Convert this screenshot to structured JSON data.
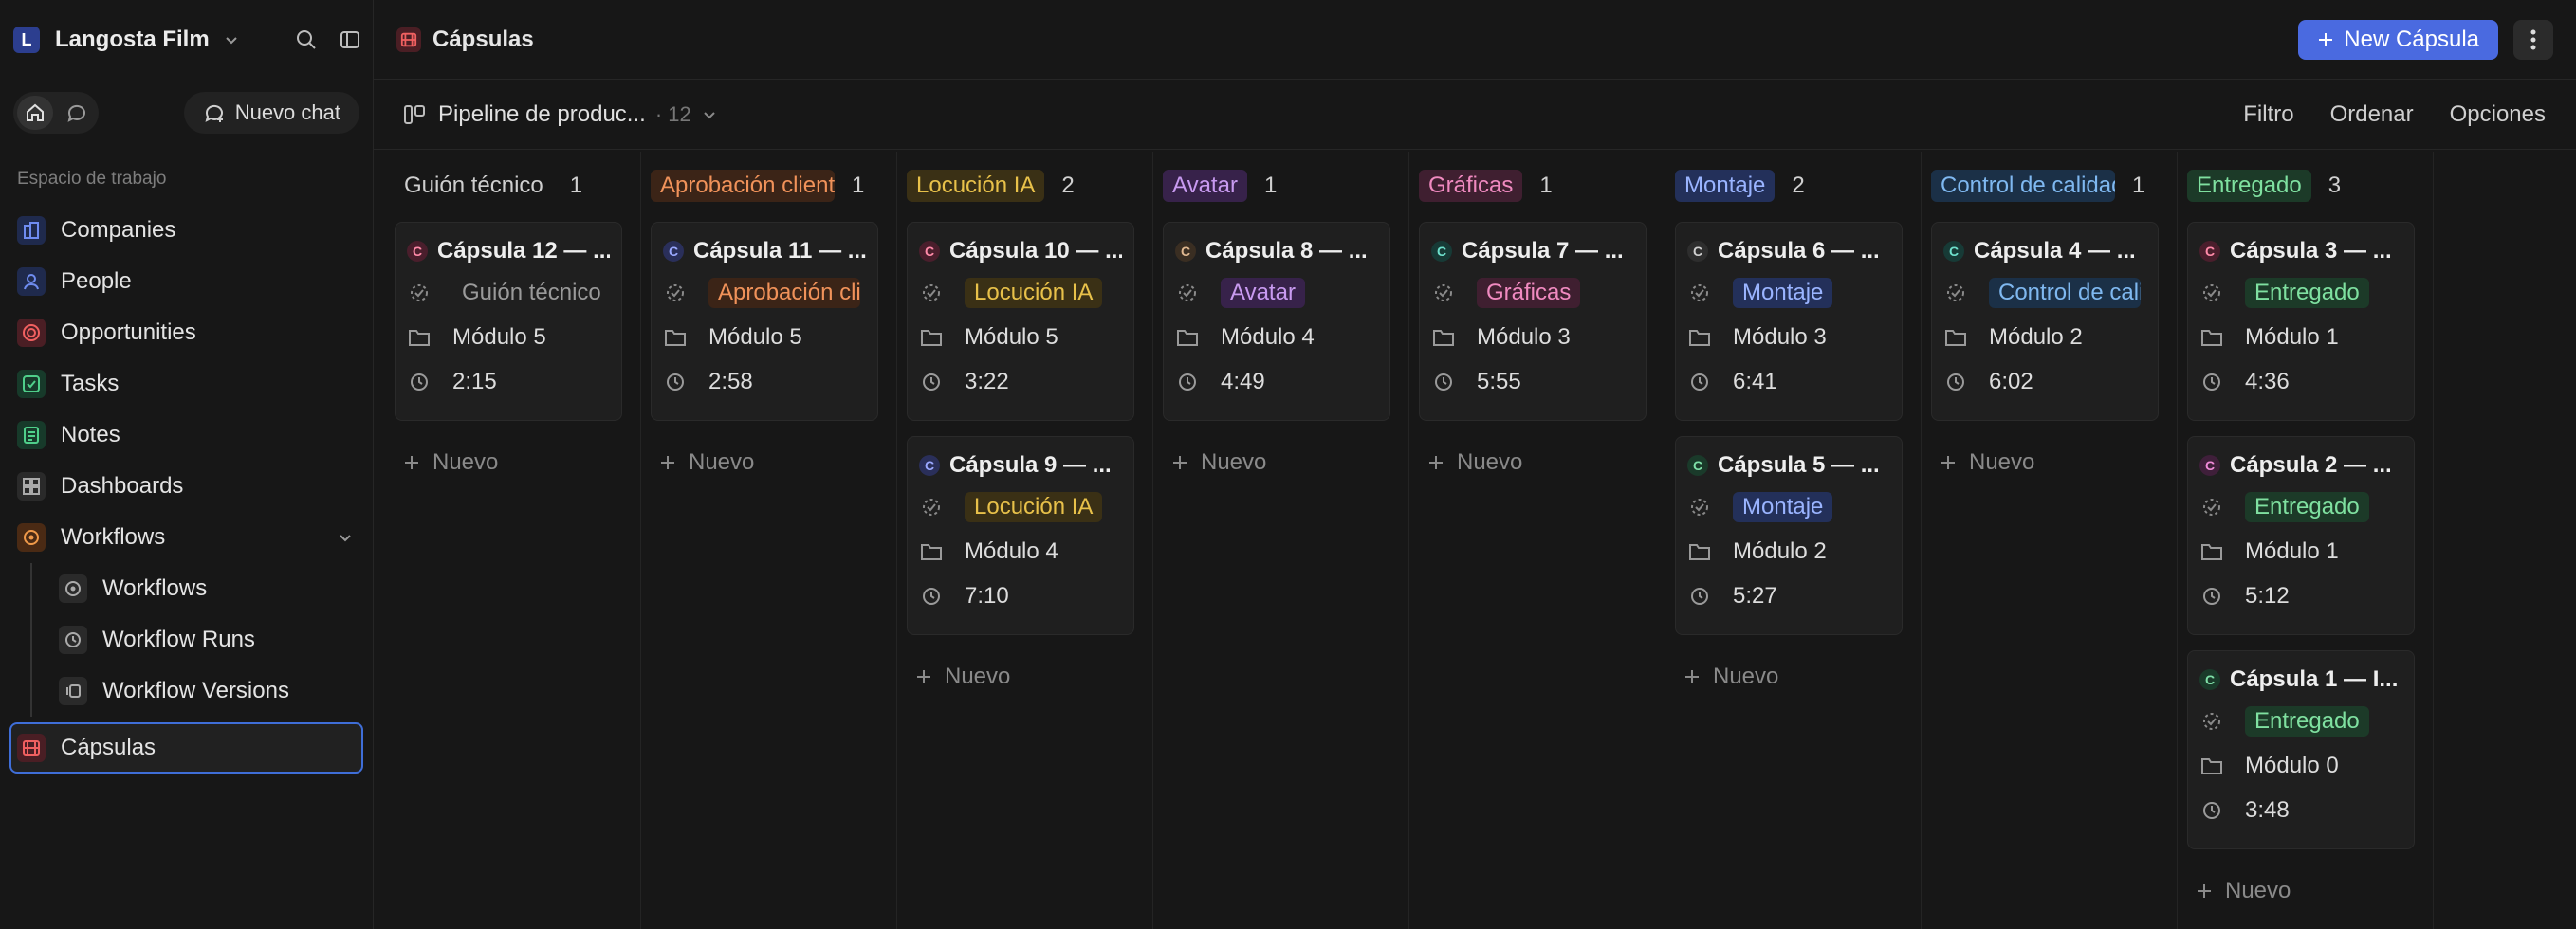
{
  "workspace": {
    "initial": "L",
    "name": "Langosta Film"
  },
  "sidebar": {
    "new_chat": "Nuevo chat",
    "section": "Espacio de trabajo",
    "items": [
      {
        "label": "Companies",
        "icon": "building-icon",
        "color": "#5b7be6"
      },
      {
        "label": "People",
        "icon": "person-icon",
        "color": "#5b7be6"
      },
      {
        "label": "Opportunities",
        "icon": "target-icon",
        "color": "#e0524c"
      },
      {
        "label": "Tasks",
        "icon": "checkbox-icon",
        "color": "#3fb47a"
      },
      {
        "label": "Notes",
        "icon": "note-icon",
        "color": "#3fb47a"
      },
      {
        "label": "Dashboards",
        "icon": "grid-icon",
        "color": "#9a9a9a"
      },
      {
        "label": "Workflows",
        "icon": "workflow-icon",
        "color": "#e8863a"
      }
    ],
    "sub_items": [
      {
        "label": "Workflows",
        "icon": "workflow-icon"
      },
      {
        "label": "Workflow Runs",
        "icon": "history-icon"
      },
      {
        "label": "Workflow Versions",
        "icon": "versions-icon"
      }
    ],
    "selected": {
      "label": "Cápsulas",
      "icon": "film-icon",
      "color": "#e0524c"
    }
  },
  "header": {
    "title": "Cápsulas",
    "new_button": "New Cápsula"
  },
  "view": {
    "name": "Pipeline de produc...",
    "count": "· 12",
    "actions": [
      "Filtro",
      "Ordenar",
      "Opciones"
    ]
  },
  "board": {
    "add_label": "Nuevo",
    "columns": [
      {
        "name": "Guión técnico",
        "count": "1",
        "bg": "transparent",
        "fg": "#cfcfcf",
        "cards": [
          {
            "title": "Cápsula 12 — ...",
            "av": "#4a1e2c",
            "avfg": "#ff8aa8",
            "module": "Módulo 5",
            "duration": "2:15"
          }
        ]
      },
      {
        "name": "Aprobación cliente",
        "count": "1",
        "bg": "#3b2417",
        "fg": "#f0925a",
        "cards": [
          {
            "title": "Cápsula 11 — ...",
            "av": "#2a2f5a",
            "avfg": "#9aa8ff",
            "module": "Módulo 5",
            "duration": "2:58"
          }
        ]
      },
      {
        "name": "Locución IA",
        "count": "2",
        "bg": "#3a3015",
        "fg": "#e8c14a",
        "cards": [
          {
            "title": "Cápsula 10 — ...",
            "av": "#4a1e2c",
            "avfg": "#ff8aa8",
            "module": "Módulo 5",
            "duration": "3:22"
          },
          {
            "title": "Cápsula 9 — ...",
            "av": "#2a2f5a",
            "avfg": "#9aa8ff",
            "module": "Módulo 4",
            "duration": "7:10"
          }
        ]
      },
      {
        "name": "Avatar",
        "count": "1",
        "bg": "#37224a",
        "fg": "#c89af0",
        "cards": [
          {
            "title": "Cápsula 8 — ...",
            "av": "#3a2e22",
            "avfg": "#e0b890",
            "module": "Módulo 4",
            "duration": "4:49"
          }
        ]
      },
      {
        "name": "Gráficas",
        "count": "1",
        "bg": "#3f1f30",
        "fg": "#f08ac0",
        "cards": [
          {
            "title": "Cápsula 7 — ...",
            "av": "#173a36",
            "avfg": "#6ee0cc",
            "module": "Módulo 3",
            "duration": "5:55"
          }
        ]
      },
      {
        "name": "Montaje",
        "count": "2",
        "bg": "#23305a",
        "fg": "#9ab4ff",
        "cards": [
          {
            "title": "Cápsula 6 — ...",
            "av": "#2e2e2e",
            "avfg": "#cfcfcf",
            "module": "Módulo 3",
            "duration": "6:41"
          },
          {
            "title": "Cápsula 5 — ...",
            "av": "#1a3a2a",
            "avfg": "#7fe0a8",
            "module": "Módulo 2",
            "duration": "5:27"
          }
        ]
      },
      {
        "name": "Control de calidad",
        "count": "1",
        "bg": "#1b3047",
        "fg": "#7fb8f0",
        "cards": [
          {
            "title": "Cápsula 4 — ...",
            "av": "#173a36",
            "avfg": "#6ee0cc",
            "module": "Módulo 2",
            "duration": "6:02"
          }
        ]
      },
      {
        "name": "Entregado",
        "count": "3",
        "bg": "#1c3a28",
        "fg": "#7fe0a0",
        "cards": [
          {
            "title": "Cápsula 3 — ...",
            "av": "#4a1e2c",
            "avfg": "#ff8aa8",
            "module": "Módulo 1",
            "duration": "4:36"
          },
          {
            "title": "Cápsula 2 — ...",
            "av": "#3f1f3a",
            "avfg": "#f08ad8",
            "module": "Módulo 1",
            "duration": "5:12"
          },
          {
            "title": "Cápsula 1 — I...",
            "av": "#1a3a2a",
            "avfg": "#7fe0a8",
            "module": "Módulo 0",
            "duration": "3:48"
          }
        ]
      }
    ]
  }
}
